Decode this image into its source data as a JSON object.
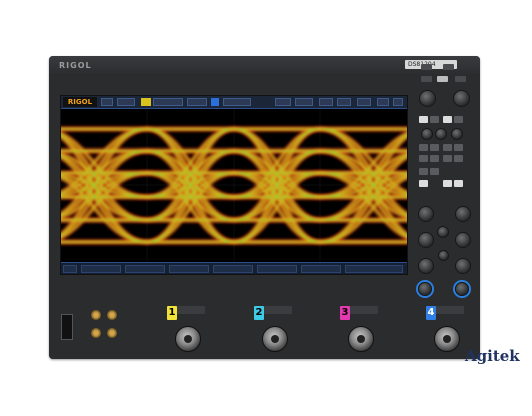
{
  "device": {
    "brand": "RIGOL",
    "model_badge": "DS81204"
  },
  "screen": {
    "logo_text": "RIGOL",
    "display": "eye-diagram"
  },
  "channels": [
    {
      "label": "1",
      "color": "#f2e33a"
    },
    {
      "label": "2",
      "color": "#3ec9e6"
    },
    {
      "label": "3",
      "color": "#e33ab0"
    },
    {
      "label": "4",
      "color": "#2f7fe6"
    }
  ],
  "watermark": "Agitek",
  "colors": {
    "eye_outer": "#d11c12",
    "eye_mid": "#f08a10",
    "eye_inner": "#f5e21c",
    "eye_core": "#38c23b"
  }
}
